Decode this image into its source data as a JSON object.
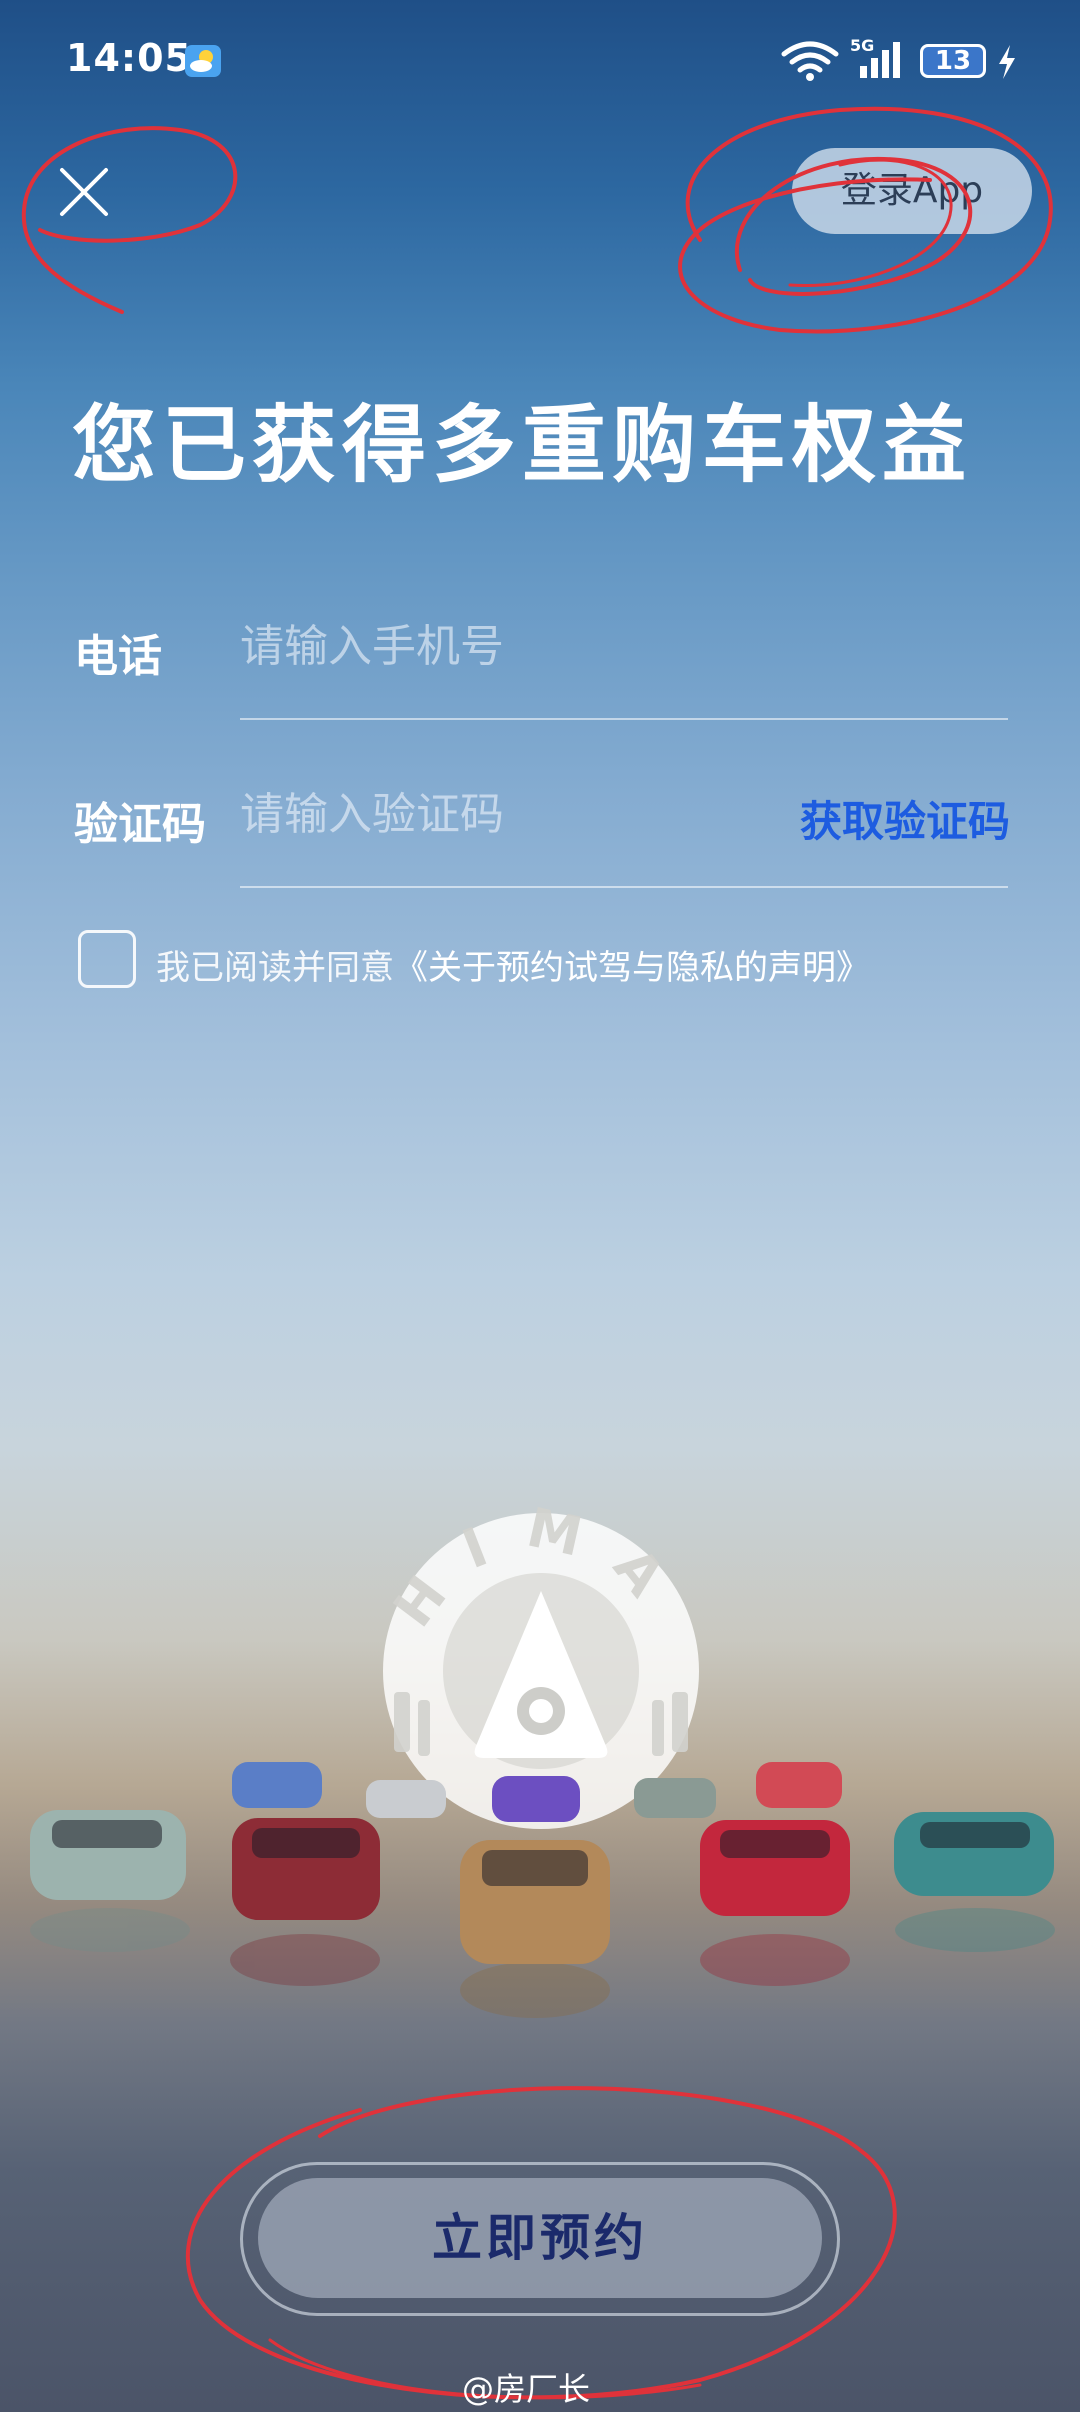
{
  "status_bar": {
    "time": "14:05",
    "weather_icon": "partly-cloudy-icon",
    "wifi_icon": "wifi-icon",
    "network": "5G",
    "signal_icon": "signal-bars-icon",
    "battery": "13",
    "charging_icon": "lightning-icon"
  },
  "header": {
    "close_icon": "close-icon",
    "login_label": "登录App"
  },
  "headline": "您已获得多重购车权益",
  "form": {
    "phone_label": "电话",
    "phone_placeholder": "请输入手机号",
    "phone_value": "",
    "code_label": "验证码",
    "code_placeholder": "请输入验证码",
    "code_value": "",
    "get_code_label": "获取验证码"
  },
  "agreement": {
    "checked": false,
    "prefix": "我已阅读并同意",
    "link": "《关于预约试驾与隐私的声明》"
  },
  "brand": {
    "emblem_text": "HIMA",
    "emblem_icon": "hima-logo-icon"
  },
  "cta": {
    "reserve_label": "立即预约"
  },
  "watermark": "@房厂长",
  "colors": {
    "link_blue": "#1d5ce0",
    "button_text": "#1b2a6b",
    "annotation_red": "#e0323a"
  }
}
